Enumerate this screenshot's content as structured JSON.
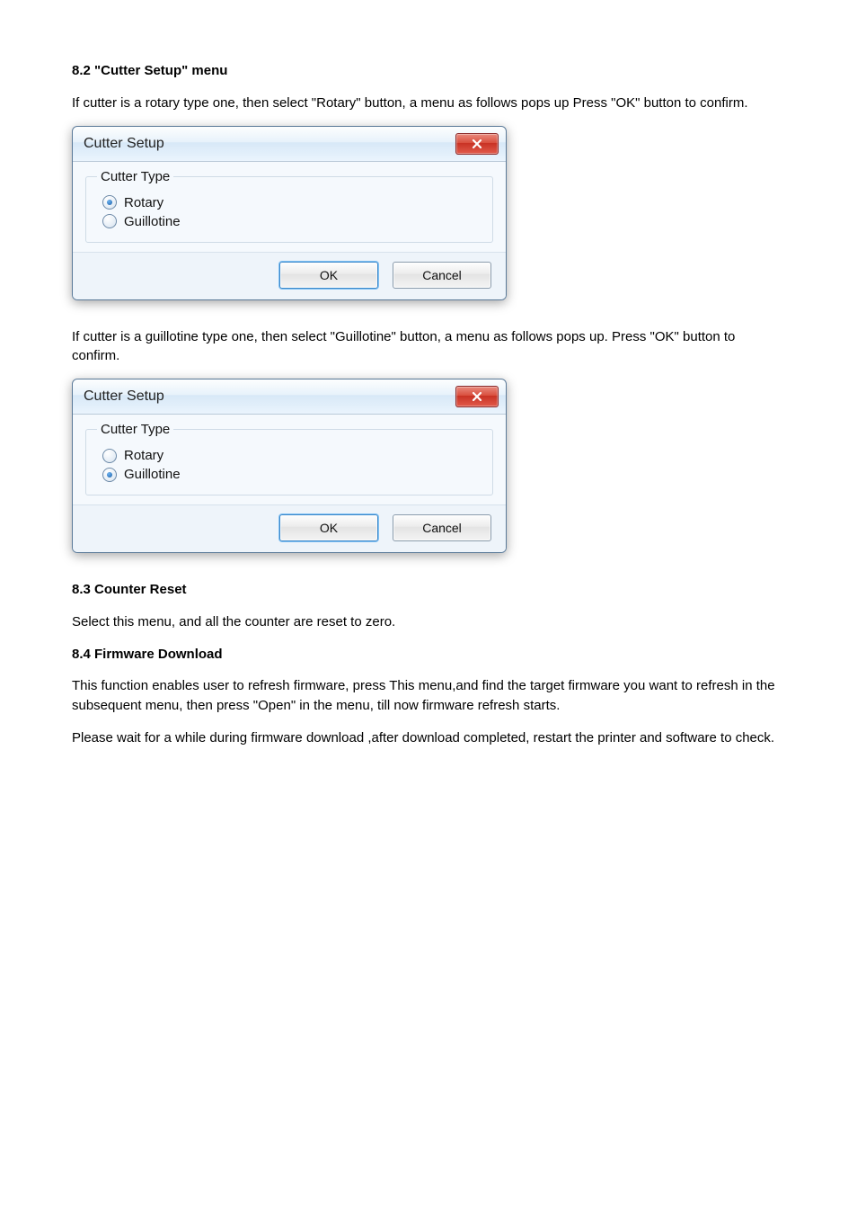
{
  "text": {
    "heading_menu": "8.2 \"Cutter Setup\" menu",
    "para1_prefix": "If cutter is a rotary type one, then select \"Rotary\" button, a menu as follows pops up",
    "para1_suffix": "Press \"OK\" button to confirm.",
    "para2_prefix": "If cutter is a guillotine type one, then select \"Guillotine\" button, a menu as follows pops up. Press",
    "para2_suffix": "\"OK\" button to confirm.",
    "heading_reset": "8.3 Counter Reset",
    "para_reset": "Select this menu, and all the counter are reset to zero.",
    "heading_fw": "8.4 Firmware Download",
    "para_fw1": "This function enables user to refresh firmware, press This menu,and find the target firmware you want to refresh in the subsequent menu, then press \"Open\" in the menu, till now firmware refresh starts.",
    "para_fw2": "Please wait for a while during firmware download ,after download completed, restart the printer and software to check."
  },
  "dialog": {
    "title": "Cutter Setup",
    "group": "Cutter Type",
    "option_rotary": "Rotary",
    "option_guillotine": "Guillotine",
    "ok": "OK",
    "cancel": "Cancel"
  }
}
